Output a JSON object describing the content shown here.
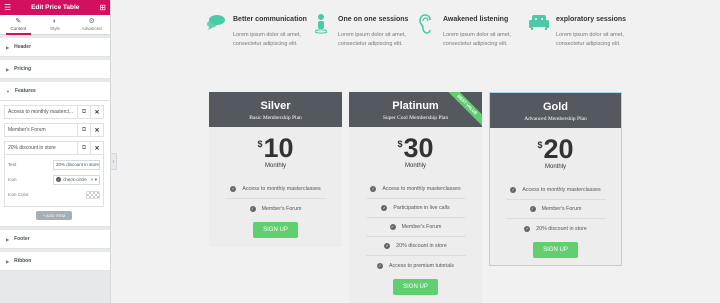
{
  "panel": {
    "title": "Edit Price Table",
    "tabs": [
      {
        "label": "Content",
        "icon": "pencil-icon"
      },
      {
        "label": "Style",
        "icon": "half-circle-icon"
      },
      {
        "label": "Advanced",
        "icon": "gear-icon"
      }
    ],
    "sections": {
      "header": "Header",
      "pricing": "Pricing",
      "features": "Features",
      "footer": "Footer",
      "ribbon": "Ribbon"
    },
    "repeater_items": [
      "Access to monthly mastercl...",
      "Member's Forum",
      "20% discount in store"
    ],
    "edit_fields": {
      "text_label": "Text",
      "text_value": "20% discount in store",
      "icon_label": "Icon",
      "icon_value": "check-circle",
      "icon_color_label": "Icon Color"
    },
    "add_item_label": "+ ADD ITEM"
  },
  "features": [
    {
      "title": "Better communication",
      "desc": "Lorem ipsum dolor sit amet, consectetur adipiscing elit.",
      "icon": "chat-bubbles-icon"
    },
    {
      "title": "One on one sessions",
      "desc": "Lorem ipsum dolor sit amet, consectetur adipiscing elit.",
      "icon": "person-icon"
    },
    {
      "title": "Awakened listening",
      "desc": "Lorem ipsum dolor sit amet, consectetur adipiscing elit.",
      "icon": "ear-icon"
    },
    {
      "title": "exploratory sessions",
      "desc": "Lorem ipsum dolor sit amet, consectetur adipiscing elit.",
      "icon": "sofa-icon"
    }
  ],
  "plans": [
    {
      "name": "Silver",
      "subtitle": "Basic Membership Plan",
      "currency": "$",
      "price": "10",
      "period": "Monthly",
      "items": [
        "Access to monthly masterclasses",
        "Member's Forum"
      ],
      "button": "SIGN UP"
    },
    {
      "name": "Platinum",
      "subtitle": "Super Cool Membership Plan",
      "currency": "$",
      "price": "30",
      "period": "Monthly",
      "items": [
        "Access to monthly masterclasses",
        "Participation in live calls",
        "Member's Forum",
        "20% discount in store",
        "Access to premium tutorials"
      ],
      "button": "SIGN UP",
      "ribbon": "BEST VALUE"
    },
    {
      "name": "Gold",
      "subtitle": "Advanced Membership Plan",
      "currency": "$",
      "price": "20",
      "period": "Monthly",
      "items": [
        "Access to monthly masterclasses",
        "Member's Forum",
        "20% discount in store"
      ],
      "button": "SIGN UP"
    }
  ],
  "colors": {
    "brand": "#d3105f",
    "accent_green": "#61ce70",
    "icon_teal": "#4cc9a6",
    "card_header": "#54595f"
  }
}
